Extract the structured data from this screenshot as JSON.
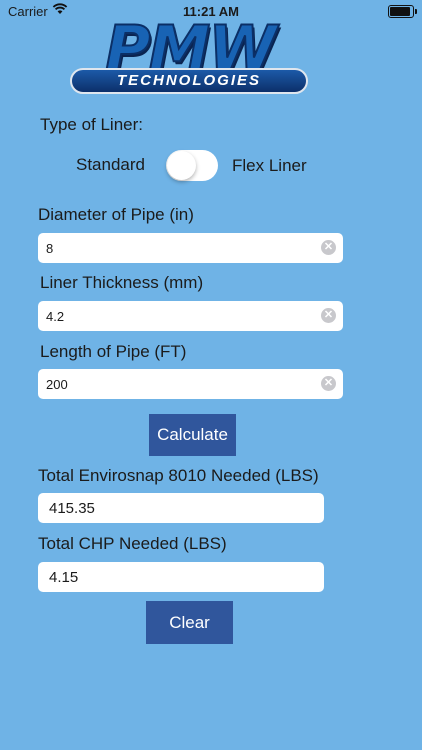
{
  "status_bar": {
    "carrier": "Carrier",
    "time": "11:21 AM"
  },
  "logo": {
    "letters": "PMW",
    "subtitle": "TECHNOLOGIES"
  },
  "liner_type": {
    "label": "Type of Liner:",
    "option_left": "Standard",
    "option_right": "Flex Liner",
    "toggle_on": false
  },
  "diameter": {
    "label": "Diameter of Pipe (in)",
    "value": "8"
  },
  "thickness": {
    "label": "Liner Thickness (mm)",
    "value": "4.2"
  },
  "length": {
    "label": "Length of Pipe (FT)",
    "value": "200"
  },
  "calculate_label": "Calculate",
  "result_envirosnap": {
    "label": "Total Envirosnap 8010 Needed (LBS)",
    "value": "415.35"
  },
  "result_chp": {
    "label": "Total CHP Needed (LBS)",
    "value": "4.15"
  },
  "clear_label": "Clear",
  "colors": {
    "background": "#6fb3e6",
    "button": "#30569c"
  },
  "icons": {
    "wifi": "wifi-icon",
    "battery": "battery-icon",
    "clear": "clear-text-icon"
  }
}
